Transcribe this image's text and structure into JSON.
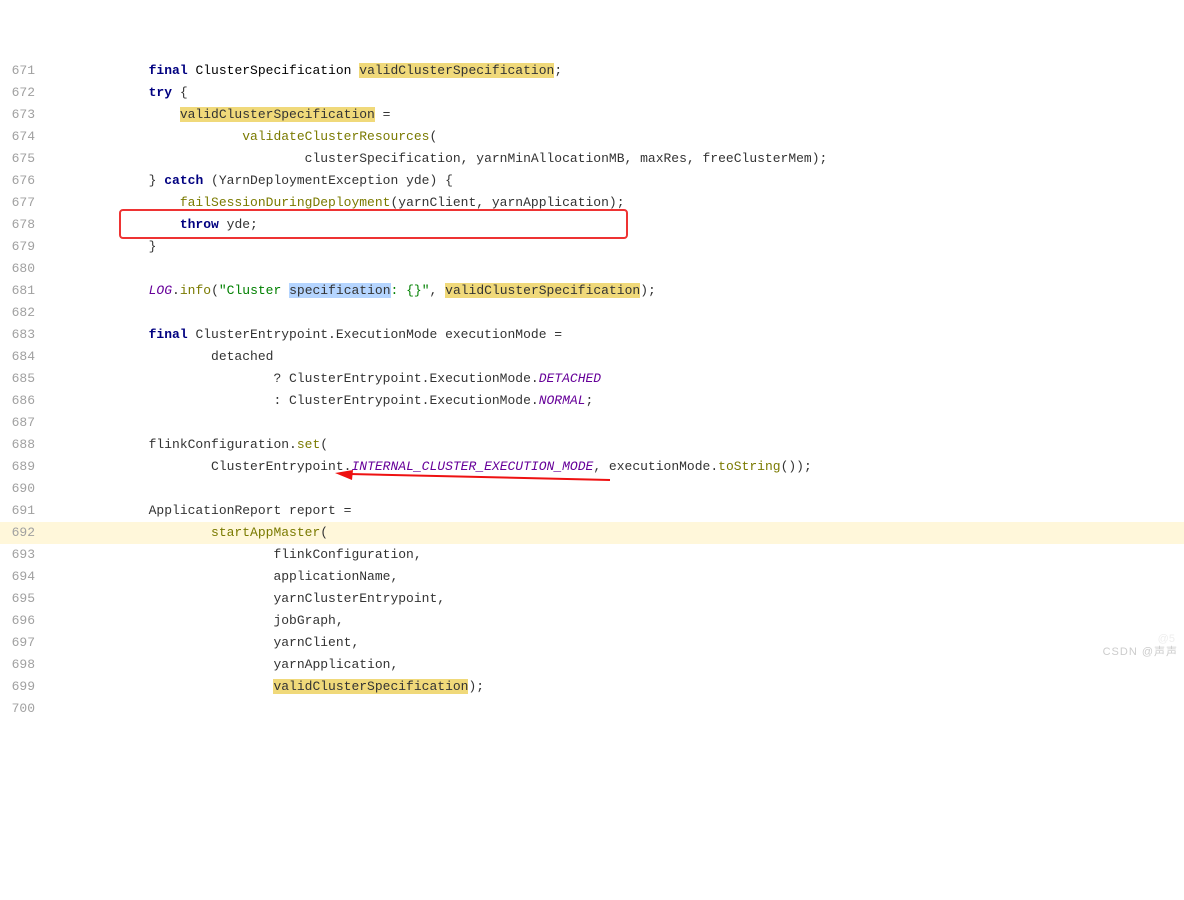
{
  "lines": [
    {
      "no": 671,
      "indent": "            ",
      "segs": [
        {
          "cls": "kw",
          "t": "final "
        },
        {
          "cls": "type",
          "t": "ClusterSpecification "
        },
        {
          "cls": "hl",
          "t": "validClusterSpecification"
        },
        {
          "cls": "",
          "t": ";"
        }
      ]
    },
    {
      "no": 672,
      "indent": "            ",
      "segs": [
        {
          "cls": "kw",
          "t": "try "
        },
        {
          "cls": "",
          "t": "{"
        }
      ]
    },
    {
      "no": 673,
      "indent": "                ",
      "segs": [
        {
          "cls": "hl",
          "t": "validClusterSpecification"
        },
        {
          "cls": "",
          "t": " ="
        }
      ]
    },
    {
      "no": 674,
      "indent": "                        ",
      "segs": [
        {
          "cls": "method",
          "t": "validateClusterResources"
        },
        {
          "cls": "",
          "t": "("
        }
      ]
    },
    {
      "no": 675,
      "indent": "                                ",
      "segs": [
        {
          "cls": "",
          "t": "clusterSpecification, yarnMinAllocationMB, maxRes, freeClusterMem);"
        }
      ]
    },
    {
      "no": 676,
      "indent": "            ",
      "segs": [
        {
          "cls": "",
          "t": "} "
        },
        {
          "cls": "kw",
          "t": "catch "
        },
        {
          "cls": "",
          "t": "(YarnDeploymentException yde) {"
        }
      ]
    },
    {
      "no": 677,
      "indent": "                ",
      "segs": [
        {
          "cls": "method",
          "t": "failSessionDuringDeployment"
        },
        {
          "cls": "",
          "t": "(yarnClient, yarnApplication);"
        }
      ]
    },
    {
      "no": 678,
      "indent": "                ",
      "segs": [
        {
          "cls": "kw",
          "t": "throw "
        },
        {
          "cls": "",
          "t": "yde;"
        }
      ]
    },
    {
      "no": 679,
      "indent": "            ",
      "segs": [
        {
          "cls": "",
          "t": "}"
        }
      ]
    },
    {
      "no": 680,
      "indent": "",
      "segs": []
    },
    {
      "no": 681,
      "indent": "            ",
      "segs": [
        {
          "cls": "const",
          "t": "LOG"
        },
        {
          "cls": "",
          "t": "."
        },
        {
          "cls": "method",
          "t": "info"
        },
        {
          "cls": "",
          "t": "("
        },
        {
          "cls": "str",
          "t": "\"Cluster "
        },
        {
          "cls": "sel",
          "t": "specification"
        },
        {
          "cls": "str",
          "t": ": {}\""
        },
        {
          "cls": "",
          "t": ", "
        },
        {
          "cls": "hl",
          "t": "validClusterSpecification"
        },
        {
          "cls": "",
          "t": ");"
        }
      ]
    },
    {
      "no": 682,
      "indent": "",
      "segs": []
    },
    {
      "no": 683,
      "indent": "            ",
      "segs": [
        {
          "cls": "kw",
          "t": "final "
        },
        {
          "cls": "",
          "t": "ClusterEntrypoint.ExecutionMode executionMode ="
        }
      ]
    },
    {
      "no": 684,
      "indent": "                    ",
      "segs": [
        {
          "cls": "",
          "t": "detached"
        }
      ]
    },
    {
      "no": 685,
      "indent": "                            ",
      "segs": [
        {
          "cls": "",
          "t": "? ClusterEntrypoint.ExecutionMode."
        },
        {
          "cls": "const",
          "t": "DETACHED"
        }
      ]
    },
    {
      "no": 686,
      "indent": "                            ",
      "segs": [
        {
          "cls": "",
          "t": ": ClusterEntrypoint.ExecutionMode."
        },
        {
          "cls": "const",
          "t": "NORMAL"
        },
        {
          "cls": "",
          "t": ";"
        }
      ]
    },
    {
      "no": 687,
      "indent": "",
      "segs": []
    },
    {
      "no": 688,
      "indent": "            ",
      "segs": [
        {
          "cls": "",
          "t": "flinkConfiguration."
        },
        {
          "cls": "method",
          "t": "set"
        },
        {
          "cls": "",
          "t": "("
        }
      ]
    },
    {
      "no": 689,
      "indent": "                    ",
      "segs": [
        {
          "cls": "",
          "t": "ClusterEntrypoint."
        },
        {
          "cls": "const",
          "t": "INTERNAL_CLUSTER_EXECUTION_MODE"
        },
        {
          "cls": "",
          "t": ", executionMode."
        },
        {
          "cls": "method",
          "t": "toString"
        },
        {
          "cls": "",
          "t": "());"
        }
      ]
    },
    {
      "no": 690,
      "indent": "",
      "segs": []
    },
    {
      "no": 691,
      "indent": "            ",
      "segs": [
        {
          "cls": "",
          "t": "ApplicationReport report ="
        }
      ]
    },
    {
      "no": 692,
      "hl": true,
      "indent": "                    ",
      "segs": [
        {
          "cls": "method",
          "t": "startAppMaster"
        },
        {
          "cls": "",
          "t": "("
        }
      ]
    },
    {
      "no": 693,
      "indent": "                            ",
      "segs": [
        {
          "cls": "",
          "t": "flinkConfiguration,"
        }
      ]
    },
    {
      "no": 694,
      "indent": "                            ",
      "segs": [
        {
          "cls": "",
          "t": "applicationName,"
        }
      ]
    },
    {
      "no": 695,
      "indent": "                            ",
      "segs": [
        {
          "cls": "",
          "t": "yarnClusterEntrypoint,"
        }
      ]
    },
    {
      "no": 696,
      "indent": "                            ",
      "segs": [
        {
          "cls": "",
          "t": "jobGraph,"
        }
      ]
    },
    {
      "no": 697,
      "indent": "                            ",
      "segs": [
        {
          "cls": "",
          "t": "yarnClient,"
        }
      ]
    },
    {
      "no": 698,
      "indent": "                            ",
      "segs": [
        {
          "cls": "",
          "t": "yarnApplication,"
        }
      ]
    },
    {
      "no": 699,
      "indent": "                            ",
      "segs": [
        {
          "cls": "hl",
          "t": "validClusterSpecification"
        },
        {
          "cls": "",
          "t": ");"
        }
      ]
    },
    {
      "no": 700,
      "indent": "",
      "segs": []
    }
  ],
  "watermark_top": "@5 ",
  "watermark": "CSDN @声声"
}
